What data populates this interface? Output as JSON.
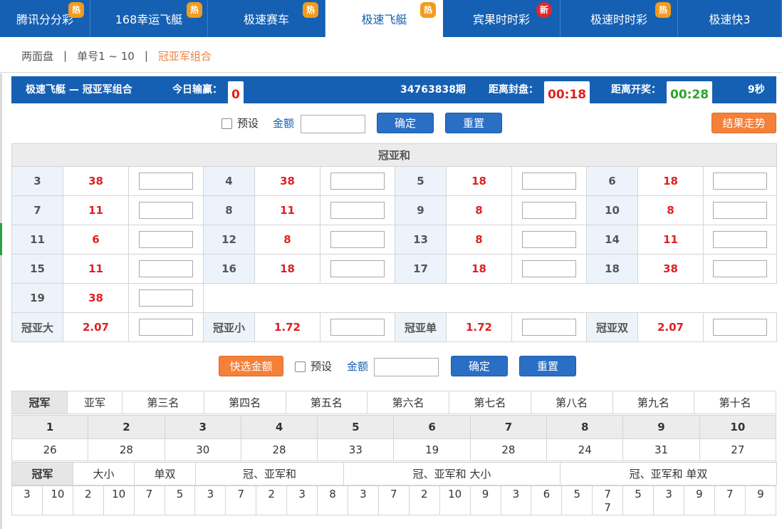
{
  "tabs": [
    {
      "label": "腾讯分分彩",
      "badge": "热",
      "badge_type": "hot"
    },
    {
      "label": "168幸运飞艇",
      "badge": "热",
      "badge_type": "hot"
    },
    {
      "label": "极速赛车",
      "badge": "热",
      "badge_type": "hot"
    },
    {
      "label": "极速飞艇",
      "badge": "热",
      "badge_type": "hot",
      "active": true
    },
    {
      "label": "宾果时时彩",
      "badge": "新",
      "badge_type": "new"
    },
    {
      "label": "极速时时彩",
      "badge": "热",
      "badge_type": "hot"
    },
    {
      "label": "极速快3",
      "badge": "",
      "badge_type": ""
    }
  ],
  "subnav": {
    "item1": "两面盘",
    "sep": "|",
    "item2": "单号1 ~ 10",
    "item3": "冠亚军组合"
  },
  "header": {
    "title": "极速飞艇 — 冠亚军组合",
    "today_label": "今日输赢：",
    "today_value": "0",
    "period": "34763838期",
    "close_label": "距离封盘：",
    "close_time": "00:18",
    "draw_label": "距离开奖：",
    "draw_time": "00:28",
    "seconds": "9秒"
  },
  "controls": {
    "preset": "预设",
    "amount": "金额",
    "confirm": "确定",
    "reset": "重置",
    "trend": "结果走势",
    "quick": "快选金额"
  },
  "odds": {
    "title": "冠亚和",
    "rows": [
      [
        [
          "3",
          "38"
        ],
        [
          "4",
          "38"
        ],
        [
          "5",
          "18"
        ],
        [
          "6",
          "18"
        ]
      ],
      [
        [
          "7",
          "11"
        ],
        [
          "8",
          "11"
        ],
        [
          "9",
          "8"
        ],
        [
          "10",
          "8"
        ]
      ],
      [
        [
          "11",
          "6"
        ],
        [
          "12",
          "8"
        ],
        [
          "13",
          "8"
        ],
        [
          "14",
          "11"
        ]
      ],
      [
        [
          "15",
          "11"
        ],
        [
          "16",
          "18"
        ],
        [
          "17",
          "18"
        ],
        [
          "18",
          "38"
        ]
      ],
      [
        [
          "19",
          "38"
        ]
      ],
      [
        [
          "冠亚大",
          "2.07"
        ],
        [
          "冠亚小",
          "1.72"
        ],
        [
          "冠亚单",
          "1.72"
        ],
        [
          "冠亚双",
          "2.07"
        ]
      ]
    ]
  },
  "stats": {
    "rank_tabs": [
      "冠军",
      "亚军",
      "第三名",
      "第四名",
      "第五名",
      "第六名",
      "第七名",
      "第八名",
      "第九名",
      "第十名"
    ],
    "numbers": [
      "1",
      "2",
      "3",
      "4",
      "5",
      "6",
      "7",
      "8",
      "9",
      "10"
    ],
    "counts": [
      "26",
      "28",
      "30",
      "28",
      "33",
      "19",
      "28",
      "24",
      "31",
      "27"
    ],
    "trend_tabs": [
      "冠军",
      "大小",
      "单双",
      "冠、亚军和",
      "冠、亚军和 大小",
      "冠、亚军和 单双"
    ],
    "history": [
      "3",
      "10",
      "2",
      "10",
      "7",
      "5",
      "3",
      "7",
      "2",
      "3",
      "8",
      "3",
      "7",
      "2",
      "10",
      "9",
      "3",
      "6",
      "5",
      "7\n7",
      "5",
      "3",
      "9",
      "7",
      "9"
    ]
  }
}
